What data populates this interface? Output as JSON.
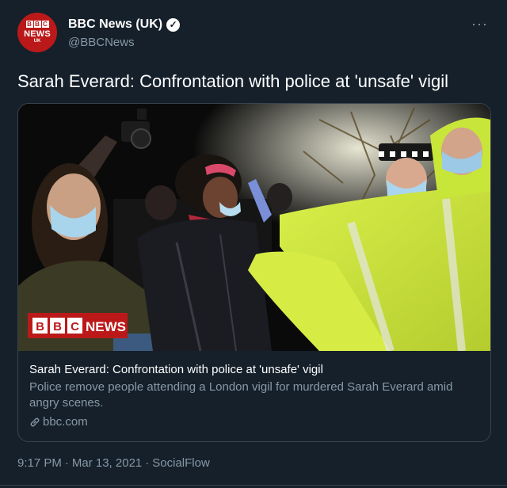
{
  "account": {
    "name": "BBC News (UK)",
    "handle": "@BBCNews",
    "avatar_logo": {
      "b1": "B",
      "b2": "B",
      "b3": "C",
      "news": "NEWS",
      "uk": "UK"
    },
    "verified_icon": "verified-badge-icon"
  },
  "more_label": "···",
  "tweet": {
    "text": "Sarah Everard: Confrontation with police at 'unsafe' vigil"
  },
  "card": {
    "image_watermark": {
      "b1": "B",
      "b2": "B",
      "b3": "C",
      "news": "NEWS"
    },
    "title": "Sarah Everard: Confrontation with police at 'unsafe' vigil",
    "description": "Police remove people attending a London vigil for murdered Sarah Everard amid angry scenes.",
    "link": "bbc.com"
  },
  "meta": {
    "time": "9:17 PM",
    "date": "Mar 13, 2021",
    "source": "SocialFlow",
    "separator": "·"
  },
  "colors": {
    "background": "#15202b",
    "secondary_text": "#8899a6",
    "border": "#38444d",
    "bbc_red": "#bb1919",
    "hi_vis": "#c8e63a"
  }
}
